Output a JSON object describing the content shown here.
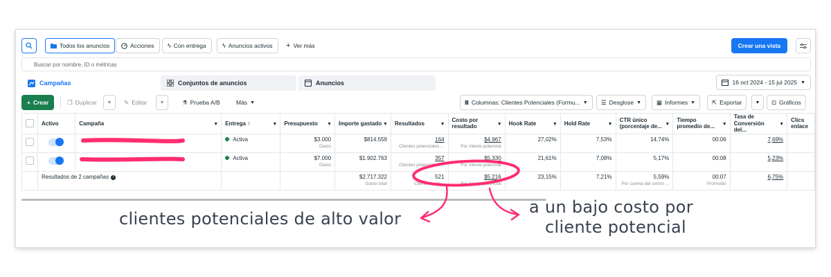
{
  "toolbar": {
    "all_ads": "Todos los anuncios",
    "actions": "Acciones",
    "with_delivery": "Con entrega",
    "active_ads": "Anuncios activos",
    "see_more": "Ver más",
    "create_view": "Crear una vista"
  },
  "search": {
    "placeholder": "Buscar por nombre, ID o métricas"
  },
  "tabs": {
    "campaigns": "Campañas",
    "ad_sets": "Conjuntos de anuncios",
    "ads": "Anuncios"
  },
  "date_range": "16 oct 2024 - 15 jul 2025",
  "actions": {
    "create": "Crear",
    "duplicate": "Duplicar",
    "edit": "Editar",
    "ab_test": "Prueba A/B",
    "more": "Más",
    "columns": "Columnas: Clientes Potenciales (Formu...",
    "breakdown": "Desglose",
    "reports": "Informes",
    "export": "Exportar",
    "charts": "Gráficos"
  },
  "table": {
    "headers": {
      "active": "Activo",
      "campaign": "Campaña",
      "delivery": "Entrega ↑",
      "budget": "Presupuesto",
      "spent": "Importe gastado",
      "results": "Resultados",
      "cost": "Costo por resultado",
      "hook": "Hook Rate",
      "hold": "Hold Rate",
      "ctr": "CTR único (porcentaje de...",
      "time": "Tiempo promedio de...",
      "conv": "Tasa de Conversión del...",
      "clicks": "Clics enlace"
    },
    "rows": [
      {
        "delivery": "Activa",
        "budget": "$3.000",
        "budget_sub": "Diario",
        "spent": "$814.559",
        "results": "164",
        "results_sub": "Clientes potenciales ...",
        "cost": "$4.967",
        "cost_sub": "Por cliente potencial",
        "hook": "27,02%",
        "hold": "7,53%",
        "ctr": "14,74%",
        "time": "00:06",
        "conv": "7,69%"
      },
      {
        "delivery": "Activa",
        "budget": "$7.000",
        "budget_sub": "Diario",
        "spent": "$1.902.763",
        "results": "357",
        "results_sub": "Clientes potenciales ...",
        "cost": "$5.330",
        "cost_sub": "Por cliente potencial",
        "hook": "21,61%",
        "hold": "7,08%",
        "ctr": "5,17%",
        "time": "00:08",
        "conv": "5,23%"
      }
    ],
    "summary": {
      "label": "Resultados de 2 campañas",
      "spent": "$2.717.322",
      "spent_sub": "Gasto total",
      "results": "521",
      "results_sub": "Clientes pote...",
      "cost": "$5.216",
      "cost_sub": "Por cliente potencial",
      "hook": "23,15%",
      "hold": "7,21%",
      "ctr": "5,59%",
      "ctr_sub": "Por cuenta del centro ...",
      "time": "00:07",
      "time_sub": "Promedio",
      "conv": "6,75%"
    }
  },
  "annotations": {
    "left": "clientes potenciales de alto valor",
    "right_line1": "a un bajo costo por",
    "right_line2": "cliente potencial"
  },
  "colors": {
    "accent": "#1877f2",
    "create": "#1a7f4e",
    "highlight": "#ff2d6f"
  }
}
